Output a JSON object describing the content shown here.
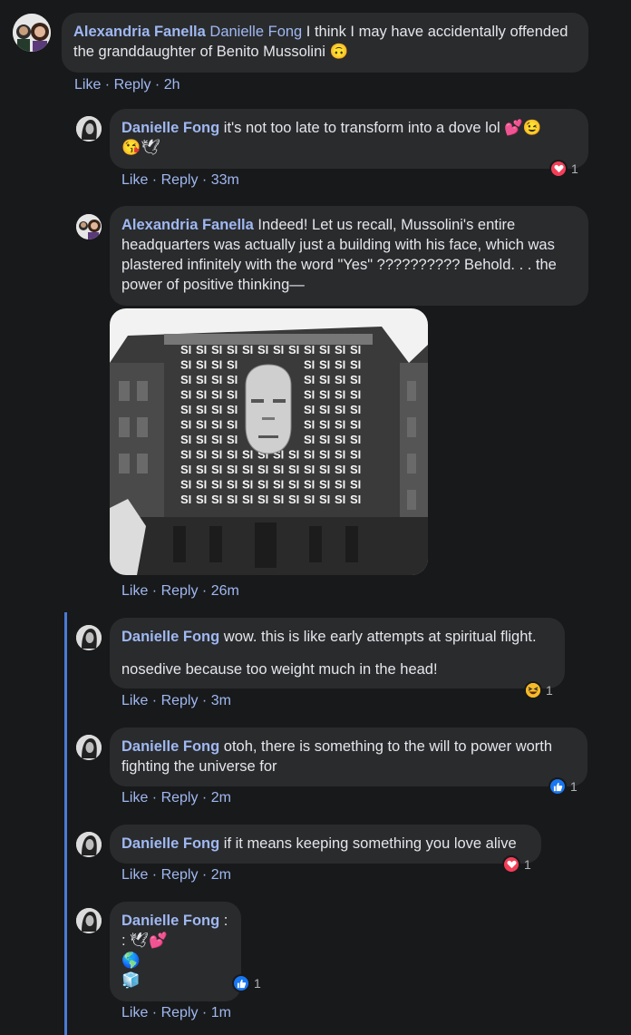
{
  "comments": [
    {
      "author": "Alexandria Fanella",
      "mention": "Danielle Fong",
      "text": " I think I may have accidentally offended the granddaughter of Benito Mussolini 🙃",
      "like": "Like",
      "reply": "Reply",
      "time": "2h"
    },
    {
      "author": "Danielle Fong",
      "text": " it's not too late to transform into a dove lol 💕😉",
      "text2": "😘🕊",
      "like": "Like",
      "reply": "Reply",
      "time": "33m",
      "reaction_count": "1"
    },
    {
      "author": "Alexandria Fanella",
      "text": " Indeed! Let us recall, Mussolini's entire headquarters was actually just a building with his face, which was plastered infinitely with the word \"Yes\" ?????????? Behold. . . the power of positive thinking—",
      "like": "Like",
      "reply": "Reply",
      "time": "26m"
    },
    {
      "author": "Danielle Fong",
      "text": " wow. this is like early attempts at spiritual flight.",
      "text2": "nosedive because too weight much in the head!",
      "like": "Like",
      "reply": "Reply",
      "time": "3m",
      "reaction_count": "1"
    },
    {
      "author": "Danielle Fong",
      "text": " otoh, there is something to the will to power worth fighting the universe for",
      "like": "Like",
      "reply": "Reply",
      "time": "2m",
      "reaction_count": "1"
    },
    {
      "author": "Danielle Fong",
      "text": " if it means keeping something you love alive",
      "like": "Like",
      "reply": "Reply",
      "time": "2m",
      "reaction_count": "1"
    },
    {
      "author": "Danielle Fong",
      "text": " :",
      "line2": ": 🕊💕",
      "line3": "🌎",
      "line4": "🧊",
      "like": "Like",
      "reply": "Reply",
      "time": "1m",
      "reaction_count": "1"
    }
  ],
  "photo": {
    "sign_word": "SI"
  },
  "separator": " · ",
  "colors": {
    "background": "#18191a",
    "bubble": "#2a2b2d",
    "link": "#9fb8f2",
    "heart": "#f33e58",
    "like": "#1877f2",
    "thread_line": "#4a7bd6"
  }
}
